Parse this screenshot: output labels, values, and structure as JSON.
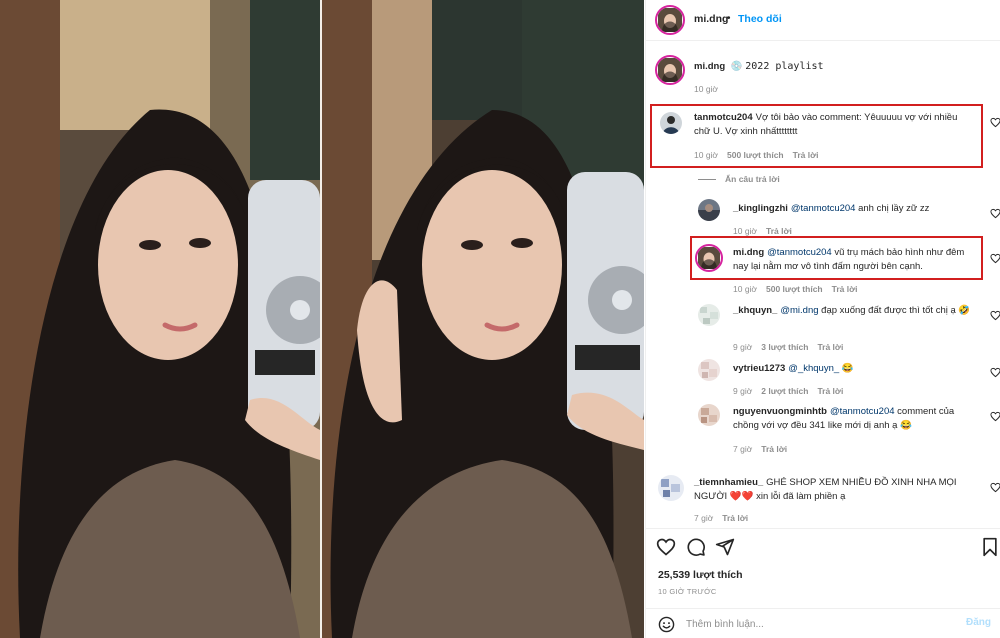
{
  "post": {
    "author": "mi.dng",
    "separator": "•",
    "follow_label": "Theo dõi",
    "caption_user": "mi.dng",
    "caption_emoji": "💿",
    "caption_text": "2022 playlist",
    "caption_time": "10 giờ"
  },
  "comments": [
    {
      "user": "tanmotcu204",
      "text": "Vợ tôi bảo vào comment: Yêuuuuu vợ với nhiều chữ U. Vợ xinh nhấtttttttt",
      "time": "10 giờ",
      "likes": "500 lượt thích",
      "reply": "Trả lời",
      "toggle_replies": "Ẩn câu trả lời"
    },
    {
      "user": "_kinglingzhi",
      "mention": "@tanmotcu204",
      "text": "anh chị lầy zữ zz",
      "time": "10 giờ",
      "reply": "Trả lời"
    },
    {
      "user": "mi.dng",
      "mention": "@tanmotcu204",
      "text": "vũ trụ mách bảo hình như đêm nay lại nằm mơ vô tình đấm người bên cạnh.",
      "time": "10 giờ",
      "likes": "500 lượt thích",
      "reply": "Trả lời"
    },
    {
      "user": "_khquyn_",
      "mention": "@mi.dng",
      "text": "đạp xuống đất được thì tốt chị ạ",
      "emoji": "🤣",
      "time": "9 giờ",
      "likes": "3 lượt thích",
      "reply": "Trả lời"
    },
    {
      "user": "vytrieu1273",
      "mention": "@_khquyn_",
      "text": "",
      "emoji": "😂",
      "time": "9 giờ",
      "likes": "2 lượt thích",
      "reply": "Trả lời"
    },
    {
      "user": "nguyenvuongminhtb",
      "mention": "@tanmotcu204",
      "text": "comment của chồng với vợ đều 341 like mới dị anh ạ",
      "emoji": "😂",
      "time": "7 giờ",
      "reply": "Trả lời"
    },
    {
      "user": "_tiemnhamieu_",
      "text": "GHÉ SHOP XEM NHIỀU ĐỒ XINH NHA MỌI NGƯỜI",
      "emoji": "❤️❤️",
      "text2": "xin lỗi đã làm phiền ạ",
      "time": "7 giờ",
      "reply": "Trả lời"
    }
  ],
  "footer": {
    "likes": "25,539 lượt thích",
    "posted": "10 GIỜ TRƯỚC",
    "comment_placeholder": "Thêm bình luận...",
    "post_label": "Đăng"
  },
  "icons": [
    "heart-icon",
    "comment-icon",
    "share-icon",
    "bookmark-icon",
    "emoji-icon"
  ],
  "colors": {
    "link": "#0095f6",
    "highlight": "#d21f1f",
    "muted": "#8e8e8e"
  }
}
